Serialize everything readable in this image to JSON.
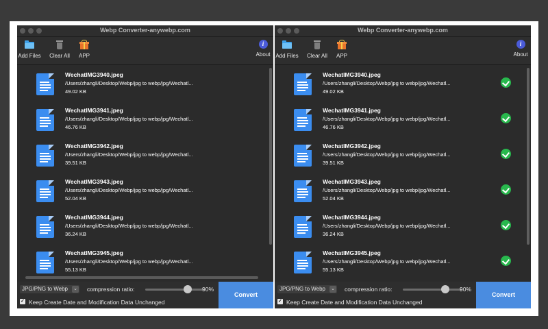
{
  "app": {
    "title": "Webp Converter-anywebp.com"
  },
  "toolbar": {
    "add_files": "Add Files",
    "clear_all": "Clear All",
    "app": "APP",
    "about": "About",
    "about_glyph": "i"
  },
  "files": [
    {
      "name": "WechatIMG3940.jpeg",
      "path": "/Users/zhangli/Desktop/Webp/jpg to webp/jpg/Wechatl...",
      "size": "49.02 KB"
    },
    {
      "name": "WechatIMG3941.jpeg",
      "path": "/Users/zhangli/Desktop/Webp/jpg to webp/jpg/Wechatl...",
      "size": "46.76 KB"
    },
    {
      "name": "WechatIMG3942.jpeg",
      "path": "/Users/zhangli/Desktop/Webp/jpg to webp/jpg/Wechatl...",
      "size": "39.51 KB"
    },
    {
      "name": "WechatIMG3943.jpeg",
      "path": "/Users/zhangli/Desktop/Webp/jpg to webp/jpg/Wechatl...",
      "size": "52.04 KB"
    },
    {
      "name": "WechatIMG3944.jpeg",
      "path": "/Users/zhangli/Desktop/Webp/jpg to webp/jpg/Wechatl...",
      "size": "36.24 KB"
    },
    {
      "name": "WechatIMG3945.jpeg",
      "path": "/Users/zhangli/Desktop/Webp/jpg to webp/jpg/Wechatl...",
      "size": "55.13 KB"
    }
  ],
  "bottom": {
    "mode_selected": "JPG/PNG to Webp",
    "compression_label": "compression ratio:",
    "compression_value": "90%",
    "compression_fraction": 0.9,
    "keep_label": "Keep Create Date and Modification Data Unchanged",
    "keep_checked": true,
    "convert_label": "Convert"
  },
  "windows": [
    {
      "id": "before",
      "converted": false
    },
    {
      "id": "after",
      "converted": true
    }
  ],
  "colors": {
    "accent": "#4a8ce0",
    "success": "#28b84d",
    "doc_icon": "#3b8df0"
  }
}
